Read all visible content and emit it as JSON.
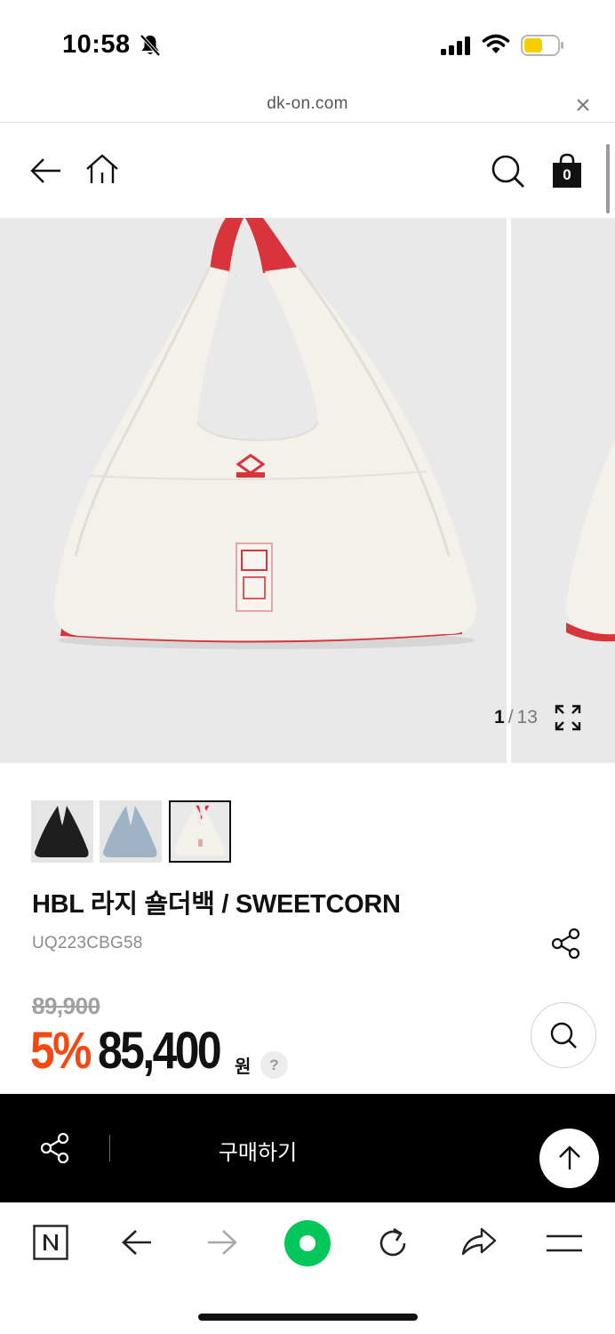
{
  "status_bar": {
    "time": "10:58"
  },
  "browser": {
    "url": "dk-on.com"
  },
  "header": {
    "cart_count": "0"
  },
  "gallery": {
    "current": "1",
    "separator": "/",
    "total": "13"
  },
  "product": {
    "title": "HBL 라지 숄더백 / SWEETCORN",
    "code": "UQ223CBG58",
    "original_price": "89,900",
    "discount": "5%",
    "price": "85,400",
    "currency": "원",
    "help": "?"
  },
  "purchase_bar": {
    "buy_label": "구매하기"
  },
  "colors": {
    "accent_discount": "#f24a12",
    "strap_red": "#d9343b",
    "bag_cream": "#f4f0ea",
    "naver_green": "#03c75a"
  }
}
